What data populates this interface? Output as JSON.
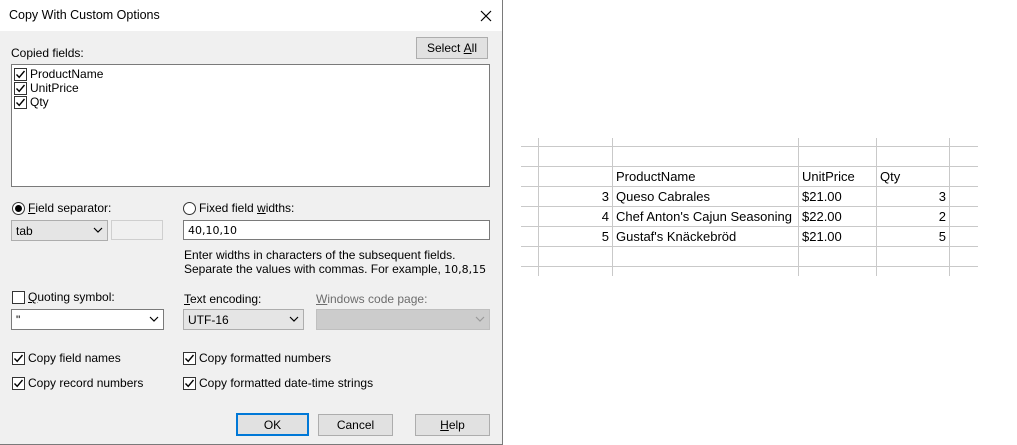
{
  "dialog": {
    "title": "Copy With Custom Options",
    "copied_fields_label": "Copied fields:",
    "select_all_pre": "Select ",
    "select_all_ul": "A",
    "select_all_post": "ll",
    "fields": [
      {
        "name": "ProductName",
        "checked": true
      },
      {
        "name": "UnitPrice",
        "checked": true
      },
      {
        "name": "Qty",
        "checked": true
      }
    ],
    "field_separator": {
      "ul": "F",
      "rest": "ield separator:",
      "selected": true,
      "value": "tab"
    },
    "fixed_widths": {
      "pre": "Fixed field ",
      "ul": "w",
      "post": "idths:",
      "selected": false,
      "value": "40,10,10"
    },
    "hint_line1": "Enter widths in characters of the subsequent fields.",
    "hint_line2_pre": "Separate the values with commas. For example, ",
    "hint_line2_example": "10,8,15",
    "quoting": {
      "pre": "",
      "ul": "Q",
      "post": "uoting symbol:",
      "checked": false,
      "value": "\""
    },
    "text_encoding": {
      "ul": "T",
      "post": "ext encoding:",
      "value": "UTF-16"
    },
    "code_page": {
      "ul": "W",
      "post": "indows code page:",
      "value": ""
    },
    "options": {
      "copy_field_names": {
        "label": "Copy field names",
        "checked": true
      },
      "copy_record_numbers": {
        "label": "Copy record numbers",
        "checked": true
      },
      "copy_formatted_numbers": {
        "label": "Copy formatted numbers",
        "checked": true
      },
      "copy_formatted_dates": {
        "label": "Copy formatted date-time strings",
        "checked": true
      }
    },
    "buttons": {
      "ok": "OK",
      "cancel": "Cancel",
      "help_ul": "H",
      "help_rest": "elp"
    }
  },
  "sheet": {
    "headers": [
      "ProductName",
      "UnitPrice",
      "Qty"
    ],
    "rows": [
      {
        "num": "3",
        "product": "Queso Cabrales",
        "price": "$21.00",
        "qty": "3"
      },
      {
        "num": "4",
        "product": "Chef Anton's Cajun Seasoning",
        "price": "$22.00",
        "qty": "2"
      },
      {
        "num": "5",
        "product": "Gustaf's Knäckebröd",
        "price": "$21.00",
        "qty": "5"
      }
    ]
  }
}
